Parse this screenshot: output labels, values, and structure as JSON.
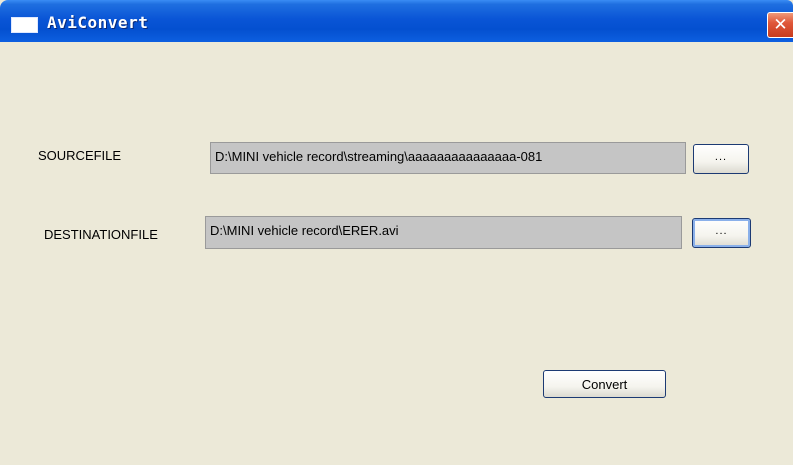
{
  "window": {
    "title": "AviConvert"
  },
  "form": {
    "source_label": "SOURCEFILE",
    "source_value": "D:\\MINI vehicle record\\streaming\\aaaaaaaaaaaaaaa-081",
    "source_browse_label": "...",
    "destination_label": "DESTINATIONFILE",
    "destination_value": "D:\\MINI vehicle record\\ERER.avi",
    "destination_browse_label": "...",
    "convert_label": "Convert"
  },
  "icons": {
    "window": "app-window-icon",
    "close": "close-icon"
  }
}
